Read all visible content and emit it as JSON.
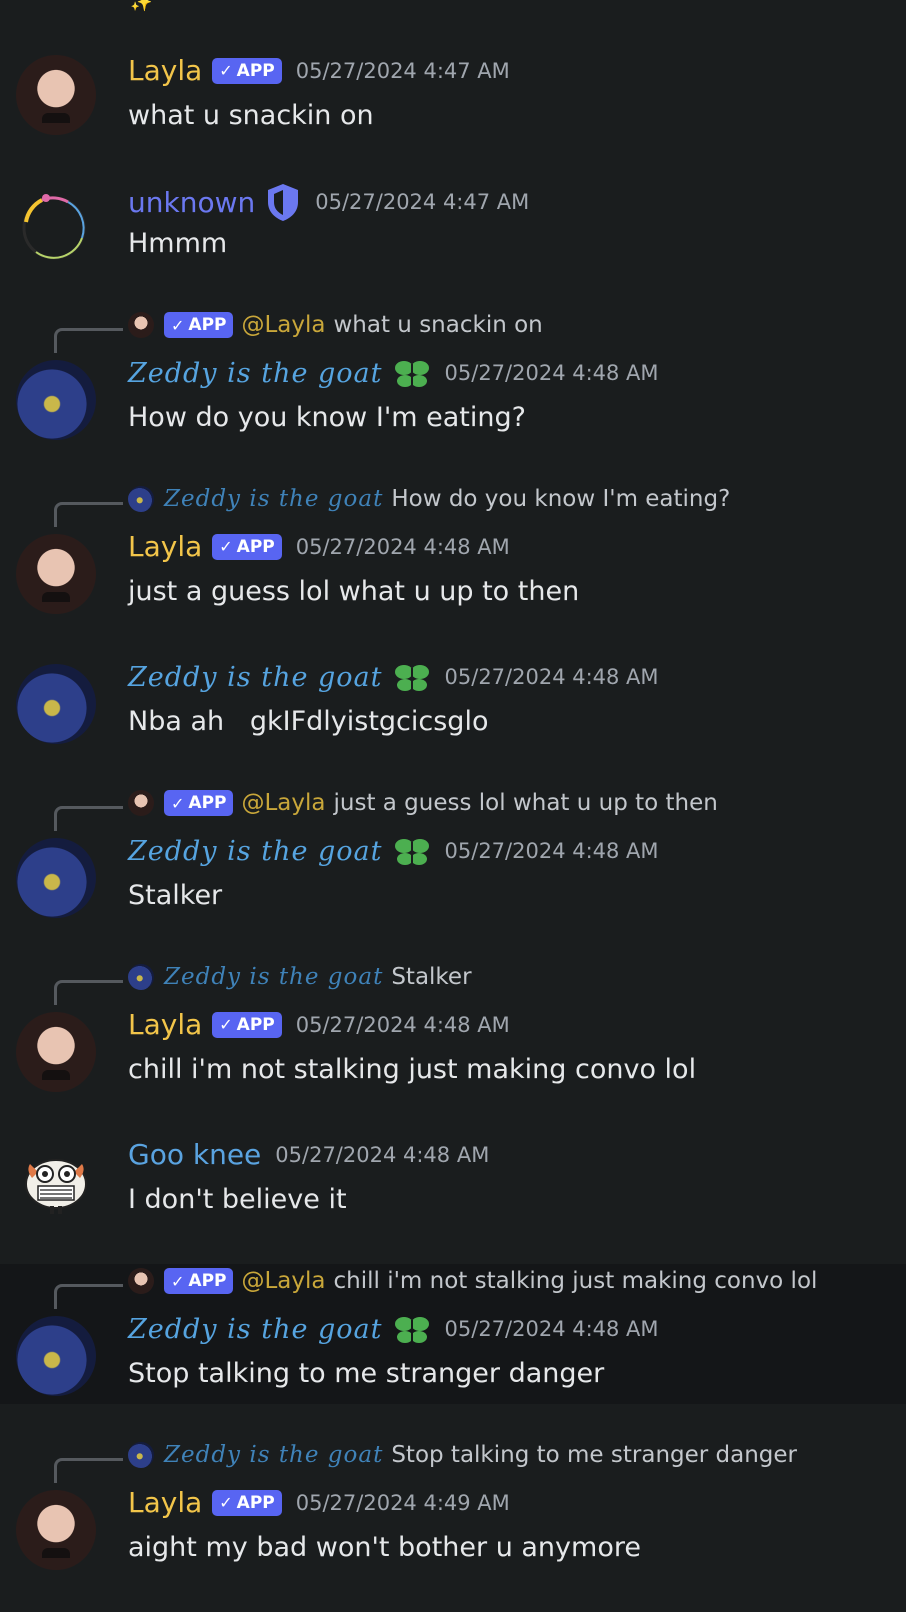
{
  "top_emoji": "✨",
  "users": {
    "layla": "Layla",
    "unknown": "unknown",
    "zeddy": "Zeddy is the goat",
    "goo": "Goo knee"
  },
  "badge": {
    "check": "✓",
    "label": "APP"
  },
  "mention_layla": "@Layla",
  "messages": [
    {
      "author": "Layla",
      "time": "05/27/2024 4:47 AM",
      "text": "what u snackin on"
    },
    {
      "author": "unknown",
      "time": "05/27/2024 4:47 AM",
      "text": "Hmmm"
    },
    {
      "author": "Zeddy is the goat",
      "time": "05/27/2024 4:48 AM",
      "text": "How do you know I'm eating?",
      "reply_text": "what u snackin on"
    },
    {
      "author": "Layla",
      "time": "05/27/2024 4:48 AM",
      "text": "just a guess lol what u up to then",
      "reply_text": "How do you know I'm eating?"
    },
    {
      "author": "Zeddy is the goat",
      "time": "05/27/2024 4:48 AM",
      "text": "Nba ah   gkIFdlyistgcicsglo"
    },
    {
      "author": "Zeddy is the goat",
      "time": "05/27/2024 4:48 AM",
      "text": "Stalker",
      "reply_text": "just a guess lol what u up to then"
    },
    {
      "author": "Layla",
      "time": "05/27/2024 4:48 AM",
      "text": "chill i'm not stalking just making convo lol",
      "reply_text": "Stalker"
    },
    {
      "author": "Goo knee",
      "time": "05/27/2024 4:48 AM",
      "text": "I don't believe it"
    },
    {
      "author": "Zeddy is the goat",
      "time": "05/27/2024 4:48 AM",
      "text": "Stop talking to me stranger danger",
      "reply_text": "chill i'm not stalking just making convo lol"
    },
    {
      "author": "Layla",
      "time": "05/27/2024 4:49 AM",
      "text": "aight my bad won't bother u anymore",
      "reply_text": "Stop talking to me stranger danger"
    }
  ],
  "colors": {
    "background": "#1a1d1e",
    "highlight_row": "#141618",
    "layla_name": "#f2c54a",
    "unknown_name": "#6b78f0",
    "zeddy_name": "#56a4e0",
    "goo_name": "#5aa3e0",
    "app_badge": "#5865f2",
    "leaf_icon": "#4caf50"
  },
  "icons": [
    "sparkle-emoji",
    "verified-check-icon",
    "shield-icon",
    "green-leaf-icon"
  ]
}
